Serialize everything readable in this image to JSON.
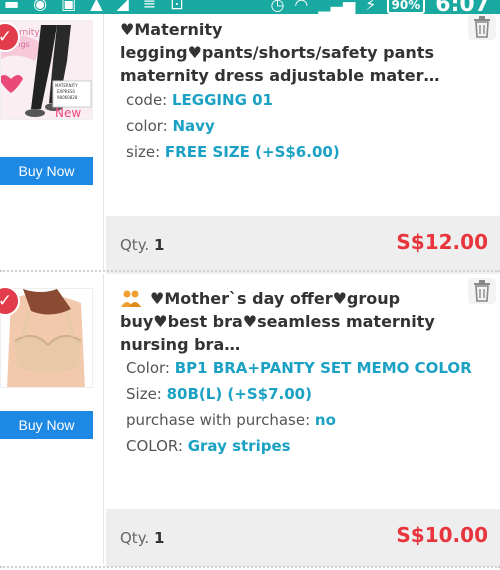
{
  "status_bar": {
    "battery": "90%",
    "time": "6:07"
  },
  "items": [
    {
      "title": "♥Maternity legging♥pants/shorts/safety pants maternity dress adjustable mater…",
      "image_text": {
        "top": "rnity",
        "left": "ggings",
        "box_line1": "MATERNITY",
        "box_line2": "EXPRESS",
        "box_line3": "98060828",
        "badge": "New"
      },
      "buy_label": "Buy Now",
      "attributes": [
        {
          "label": "code: ",
          "value": "LEGGING 01"
        },
        {
          "label": "color: ",
          "value": "Navy"
        },
        {
          "label": "size: ",
          "value": "FREE SIZE (+S$6.00)"
        }
      ],
      "qty_label": "Qty. ",
      "qty": "1",
      "price": "S$12.00"
    },
    {
      "title": "♥Mother`s day offer♥group buy♥best bra♥seamless maternity nursing bra…",
      "buy_label": "Buy Now",
      "attributes": [
        {
          "label": "Color: ",
          "value": "BP1 BRA+PANTY SET MEMO COLOR"
        },
        {
          "label": "Size: ",
          "value": "80B(L) (+S$7.00)"
        },
        {
          "label": "purchase with purchase: ",
          "value": "no"
        },
        {
          "label": "COLOR: ",
          "value": "Gray stripes"
        }
      ],
      "qty_label": "Qty. ",
      "qty": "1",
      "price": "S$10.00"
    }
  ],
  "colors": {
    "status_bar": "#19a9a0",
    "buy_button": "#1e88e5",
    "attr_value": "#1aa1c4",
    "price": "#e8343c",
    "check_badge": "#e23b4b"
  }
}
